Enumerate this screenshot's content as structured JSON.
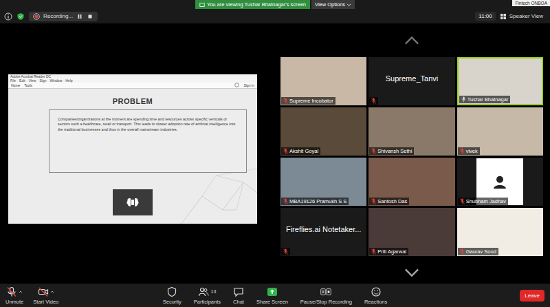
{
  "top_bar": {
    "banner": "You are viewing Tushar Bhatnagar's screen",
    "view_options": "View Options",
    "meeting_title": "Fintech ONBOA",
    "recording": "Recording...",
    "timer": "11:00",
    "view_mode": "Speaker View"
  },
  "shared_screen": {
    "app_title": "Adobe Acrobat Reader DC",
    "menu": [
      "File",
      "Edit",
      "View",
      "Sign",
      "Window",
      "Help"
    ],
    "tabs": [
      {
        "label": "Home",
        "selected": false
      },
      {
        "label": "Tools",
        "selected": false
      }
    ],
    "sign_in": "Sign In",
    "page": {
      "title": "PROBLEM",
      "body": "Companies/organizations at the moment are spending time and resources across specific verticals or sectors such a healthcare, retail or transport. This leads to slower adoption rate of artificial intelligence into the traditional businesses and thus in the overall mainstream industries."
    }
  },
  "participants": [
    {
      "name": "Supreme Incubator",
      "kind": "video",
      "muted": true,
      "active": false,
      "color": "#c9b8a6"
    },
    {
      "name": "Supreme_Tanvi",
      "kind": "name",
      "muted": true,
      "active": false,
      "color": "#1a1a1a"
    },
    {
      "name": "Tushar Bhatnagar",
      "kind": "video",
      "muted": false,
      "active": true,
      "color": "#d8d4cc"
    },
    {
      "name": "Akshit Goyal",
      "kind": "video",
      "muted": true,
      "active": false,
      "color": "#5a4a3a"
    },
    {
      "name": "Shivansh Sethi",
      "kind": "video",
      "muted": true,
      "active": false,
      "color": "#8a7868"
    },
    {
      "name": "vivek",
      "kind": "video",
      "muted": true,
      "active": false,
      "color": "#c7b9a8"
    },
    {
      "name": "MBA19126 Pramukh S S",
      "kind": "video",
      "muted": true,
      "active": false,
      "color": "#7c8a96"
    },
    {
      "name": "Santosh Das",
      "kind": "video",
      "muted": true,
      "active": false,
      "color": "#7a5a4a"
    },
    {
      "name": "Shubham Jadhav",
      "kind": "avatar",
      "muted": true,
      "active": false,
      "color": "#1a1a1a"
    },
    {
      "name": "Fireflies.ai Notetaker...",
      "kind": "name",
      "muted": true,
      "active": false,
      "color": "#1a1a1a"
    },
    {
      "name": "Priti Agarwal",
      "kind": "video",
      "muted": true,
      "active": false,
      "color": "#4a3a38"
    },
    {
      "name": "Gaurav Sood",
      "kind": "video",
      "muted": true,
      "active": false,
      "color": "#f1ede4"
    }
  ],
  "toolbar": {
    "left": [
      {
        "label": "Unmute",
        "kind": "mic"
      },
      {
        "label": "Start Video",
        "kind": "video"
      }
    ],
    "center": [
      {
        "label": "Security",
        "kind": "security",
        "count": ""
      },
      {
        "label": "Participants",
        "kind": "participants",
        "count": "13"
      },
      {
        "label": "Chat",
        "kind": "chat",
        "count": ""
      },
      {
        "label": "Share Screen",
        "kind": "share",
        "count": ""
      },
      {
        "label": "Pause/Stop Recording",
        "kind": "recording",
        "count": ""
      },
      {
        "label": "Reactions",
        "kind": "reactions",
        "count": ""
      }
    ],
    "leave": "Leave"
  }
}
